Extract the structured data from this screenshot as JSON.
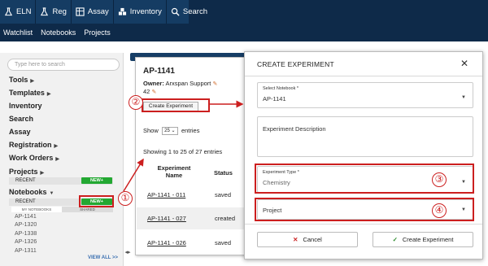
{
  "nav": {
    "items": [
      {
        "label": "ELN",
        "icon": "flask-icon"
      },
      {
        "label": "Reg",
        "icon": "flask-icon"
      },
      {
        "label": "Assay",
        "icon": "grid-icon"
      },
      {
        "label": "Inventory",
        "icon": "boxes-icon"
      },
      {
        "label": "Search",
        "icon": "search-icon"
      }
    ],
    "sub_items": [
      "Watchlist",
      "Notebooks",
      "Projects"
    ]
  },
  "sidebar": {
    "search_placeholder": "Type here to search",
    "items": {
      "tools": "Tools",
      "templates": "Templates",
      "inventory": "Inventory",
      "search": "Search",
      "assay": "Assay",
      "registration": "Registration",
      "work_orders": "Work Orders",
      "projects": "Projects",
      "notebooks": "Notebooks"
    },
    "recent_label": "RECENT",
    "new_label": "NEW+",
    "tab_my": "MY NOTEBOOKS",
    "tab_shared": "SHARED",
    "notebooks": [
      "AP-1141",
      "AP-1320",
      "AP-1338",
      "AP-1326",
      "AP-1311"
    ],
    "view_all": "VIEW ALL >>"
  },
  "notebook_panel": {
    "title": "AP-1141",
    "owner_label": "Owner:",
    "owner_name": "Arxspan Support",
    "count": "42",
    "create_button": "Create Experiment",
    "show_prefix": "Show",
    "page_size": "25",
    "show_suffix": "entries",
    "showing": "Showing 1 to 25 of 27 entries",
    "col_name_line1": "Experiment",
    "col_name_line2": "Name",
    "col_status": "Status",
    "rows": [
      {
        "name": "AP-1141 - 011",
        "status": "saved"
      },
      {
        "name": "AP-1141 - 027",
        "status": "created"
      },
      {
        "name": "AP-1141 - 026",
        "status": "saved"
      }
    ]
  },
  "modal": {
    "title": "CREATE EXPERIMENT",
    "close": "✕",
    "notebook_label": "Select Notebook *",
    "notebook_value": "AP-1141",
    "description_label": "Experiment Description",
    "type_label": "Experiment Type *",
    "type_value": "Chemistry",
    "project_label": "Project",
    "cancel": "Cancel",
    "create": "Create Experiment"
  },
  "annotations": {
    "one": "①",
    "two": "②",
    "three": "③",
    "four": "④"
  },
  "colors": {
    "nav_bg": "#0e2a49",
    "accent_green": "#23a832",
    "highlight_red": "#cc1f1f"
  }
}
